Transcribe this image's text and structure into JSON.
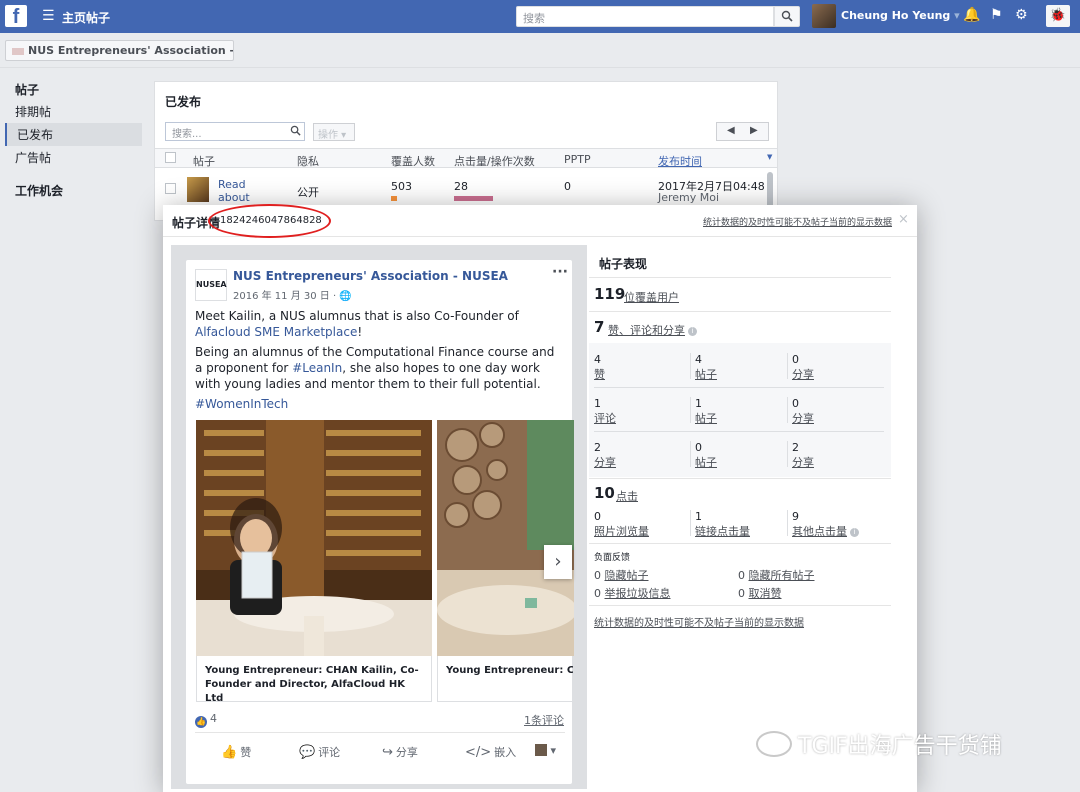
{
  "topbar": {
    "logo": "f",
    "title": "主页帖子",
    "search_placeholder": "搜索",
    "user_name": "Cheung Ho Yeung",
    "user_caret": "▾",
    "icons": [
      "bell-icon",
      "flag-icon",
      "gear-icon",
      "bug-icon"
    ]
  },
  "page_selector": {
    "label": "NUS Entrepreneurs' Association - NU",
    "caret": "▾"
  },
  "sidebar": {
    "section1": "帖子",
    "items": [
      {
        "label": "排期帖",
        "active": false
      },
      {
        "label": "已发布",
        "active": true
      },
      {
        "label": "广告帖",
        "active": false
      }
    ],
    "section2": "工作机会"
  },
  "published": {
    "title": "已发布",
    "search_placeholder": "搜索...",
    "operation_label": "操作",
    "columns": [
      "帖子",
      "隐私",
      "覆盖人数",
      "点击量/操作次数",
      "PPTP",
      "发布时间"
    ],
    "row": {
      "post_title": "Read about what Andre",
      "privacy": "公开",
      "reach": "503",
      "clicks": "28",
      "pptp": "0",
      "published_time": "2017年2月7日04:48",
      "author": "Jeremy Moi"
    }
  },
  "modal": {
    "title": "帖子详情",
    "post_id": "1824246047864828",
    "disclaimer": "统计数据的及时性可能不及帖子当前的显示数据",
    "close": "×"
  },
  "post": {
    "avatar_text": "NUSEA",
    "author": "NUS Entrepreneurs' Association - NUSEA",
    "date": "2016 年 11 月 30 日 · 🌐",
    "more": "···",
    "p1_before": "Meet Kailin, a NUS alumnus that is also Co-Founder of ",
    "p1_link": "Alfacloud SME Marketplace",
    "p1_after": "!",
    "p2_before": "Being an alumnus of the Computational Finance course and a proponent for ",
    "p2_link": "#LeanIn",
    "p2_after": ", she also hopes to one day work with young ladies and mentor them to their full potential.",
    "hashtag": "#WomenInTech",
    "card1_caption": "Young Entrepreneur: CHAN Kailin, Co-Founder and Director, AlfaCloud HK Ltd",
    "card2_caption": "Young Entrepreneur: CHAN Kailin, Co-Founder and Director, Alfa",
    "next_arrow": "›",
    "likes": "4",
    "comments": "1条评论",
    "actions": {
      "like": "赞",
      "comment": "评论",
      "share": "分享",
      "embed": "嵌入"
    }
  },
  "performance": {
    "title": "帖子表现",
    "reach_num": "119",
    "reach_label": "位覆盖用户",
    "engage_num": "7",
    "engage_label": "赞、评论和分享",
    "grid": [
      [
        {
          "num": "4",
          "label": "赞"
        },
        {
          "num": "4",
          "label": "帖子"
        },
        {
          "num": "0",
          "label": "分享"
        }
      ],
      [
        {
          "num": "1",
          "label": "评论"
        },
        {
          "num": "1",
          "label": "帖子"
        },
        {
          "num": "0",
          "label": "分享"
        }
      ],
      [
        {
          "num": "2",
          "label": "分享"
        },
        {
          "num": "0",
          "label": "帖子"
        },
        {
          "num": "2",
          "label": "分享"
        }
      ]
    ],
    "clicks_num": "10",
    "clicks_label": "点击",
    "click_breakdown": [
      {
        "num": "0",
        "label": "照片浏览量"
      },
      {
        "num": "1",
        "label": "链接点击量"
      },
      {
        "num": "9",
        "label": "其他点击量"
      }
    ],
    "negative_title": "负面反馈",
    "negative": [
      {
        "num": "0",
        "label": "隐藏帖子"
      },
      {
        "num": "0",
        "label": "隐藏所有帖子"
      },
      {
        "num": "0",
        "label": "举报垃圾信息"
      },
      {
        "num": "0",
        "label": "取消赞"
      }
    ],
    "disclaimer": "统计数据的及时性可能不及帖子当前的显示数据"
  },
  "watermark": "TGIF出海广告干货铺"
}
